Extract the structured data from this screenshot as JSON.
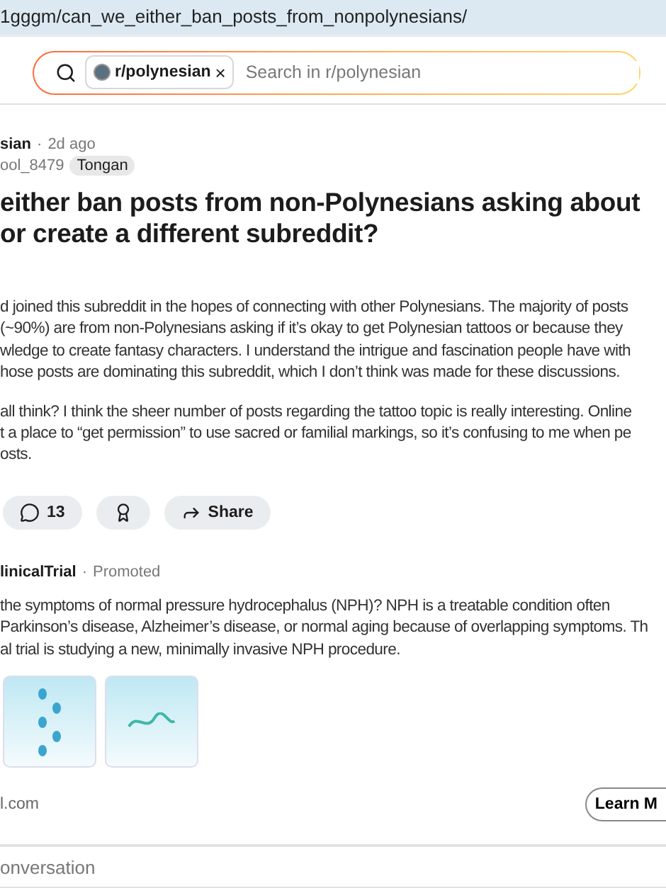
{
  "address_bar": {
    "url": "1gggm/can_we_either_ban_posts_from_nonpolynesians/"
  },
  "search": {
    "chip": "r/polynesian",
    "chip_close": "×",
    "placeholder": "Search in r/polynesian"
  },
  "post": {
    "subreddit": "sian",
    "separator": "·",
    "time": "2d ago",
    "author": "ool_8479",
    "flair": "Tongan",
    "title_lines": [
      "either ban posts from non-Polynesians asking about",
      "or create a different subreddit?"
    ],
    "paragraphs": [
      [
        "d joined this subreddit in the hopes of connecting with other Polynesians. The majority of posts",
        "(~90%) are from non-Polynesians asking if it’s okay to get Polynesian tattoos or because they",
        "wledge to create fantasy characters. I understand the intrigue and fascination people have with",
        "hose posts are dominating this subreddit, which I don’t think was made for these discussions."
      ],
      [
        "all think? I think the sheer number of posts regarding the tattoo topic is really interesting. Online",
        "t a place to “get permission” to use sacred or familial markings, so it’s confusing to me when pe",
        "osts."
      ]
    ],
    "actions": [
      {
        "kind": "comments",
        "label": "13"
      },
      {
        "kind": "award"
      },
      {
        "kind": "share",
        "label": "Share"
      }
    ]
  },
  "ad": {
    "advertiser": "linicalTrial",
    "separator": "·",
    "promoted": "Promoted",
    "lines": [
      "the symptoms of normal pressure hydrocephalus (NPH)? NPH is a treatable condition often",
      "Parkinson’s disease, Alzheimer’s disease, or normal aging because of overlapping symptoms. Th",
      "al trial is studying a new, minimally invasive NPH procedure."
    ],
    "images": [
      {
        "kind": "footprints"
      },
      {
        "kind": "logo"
      }
    ],
    "domain": "l.com",
    "button": "Learn M"
  },
  "conversation": {
    "placeholder": "onversation"
  }
}
